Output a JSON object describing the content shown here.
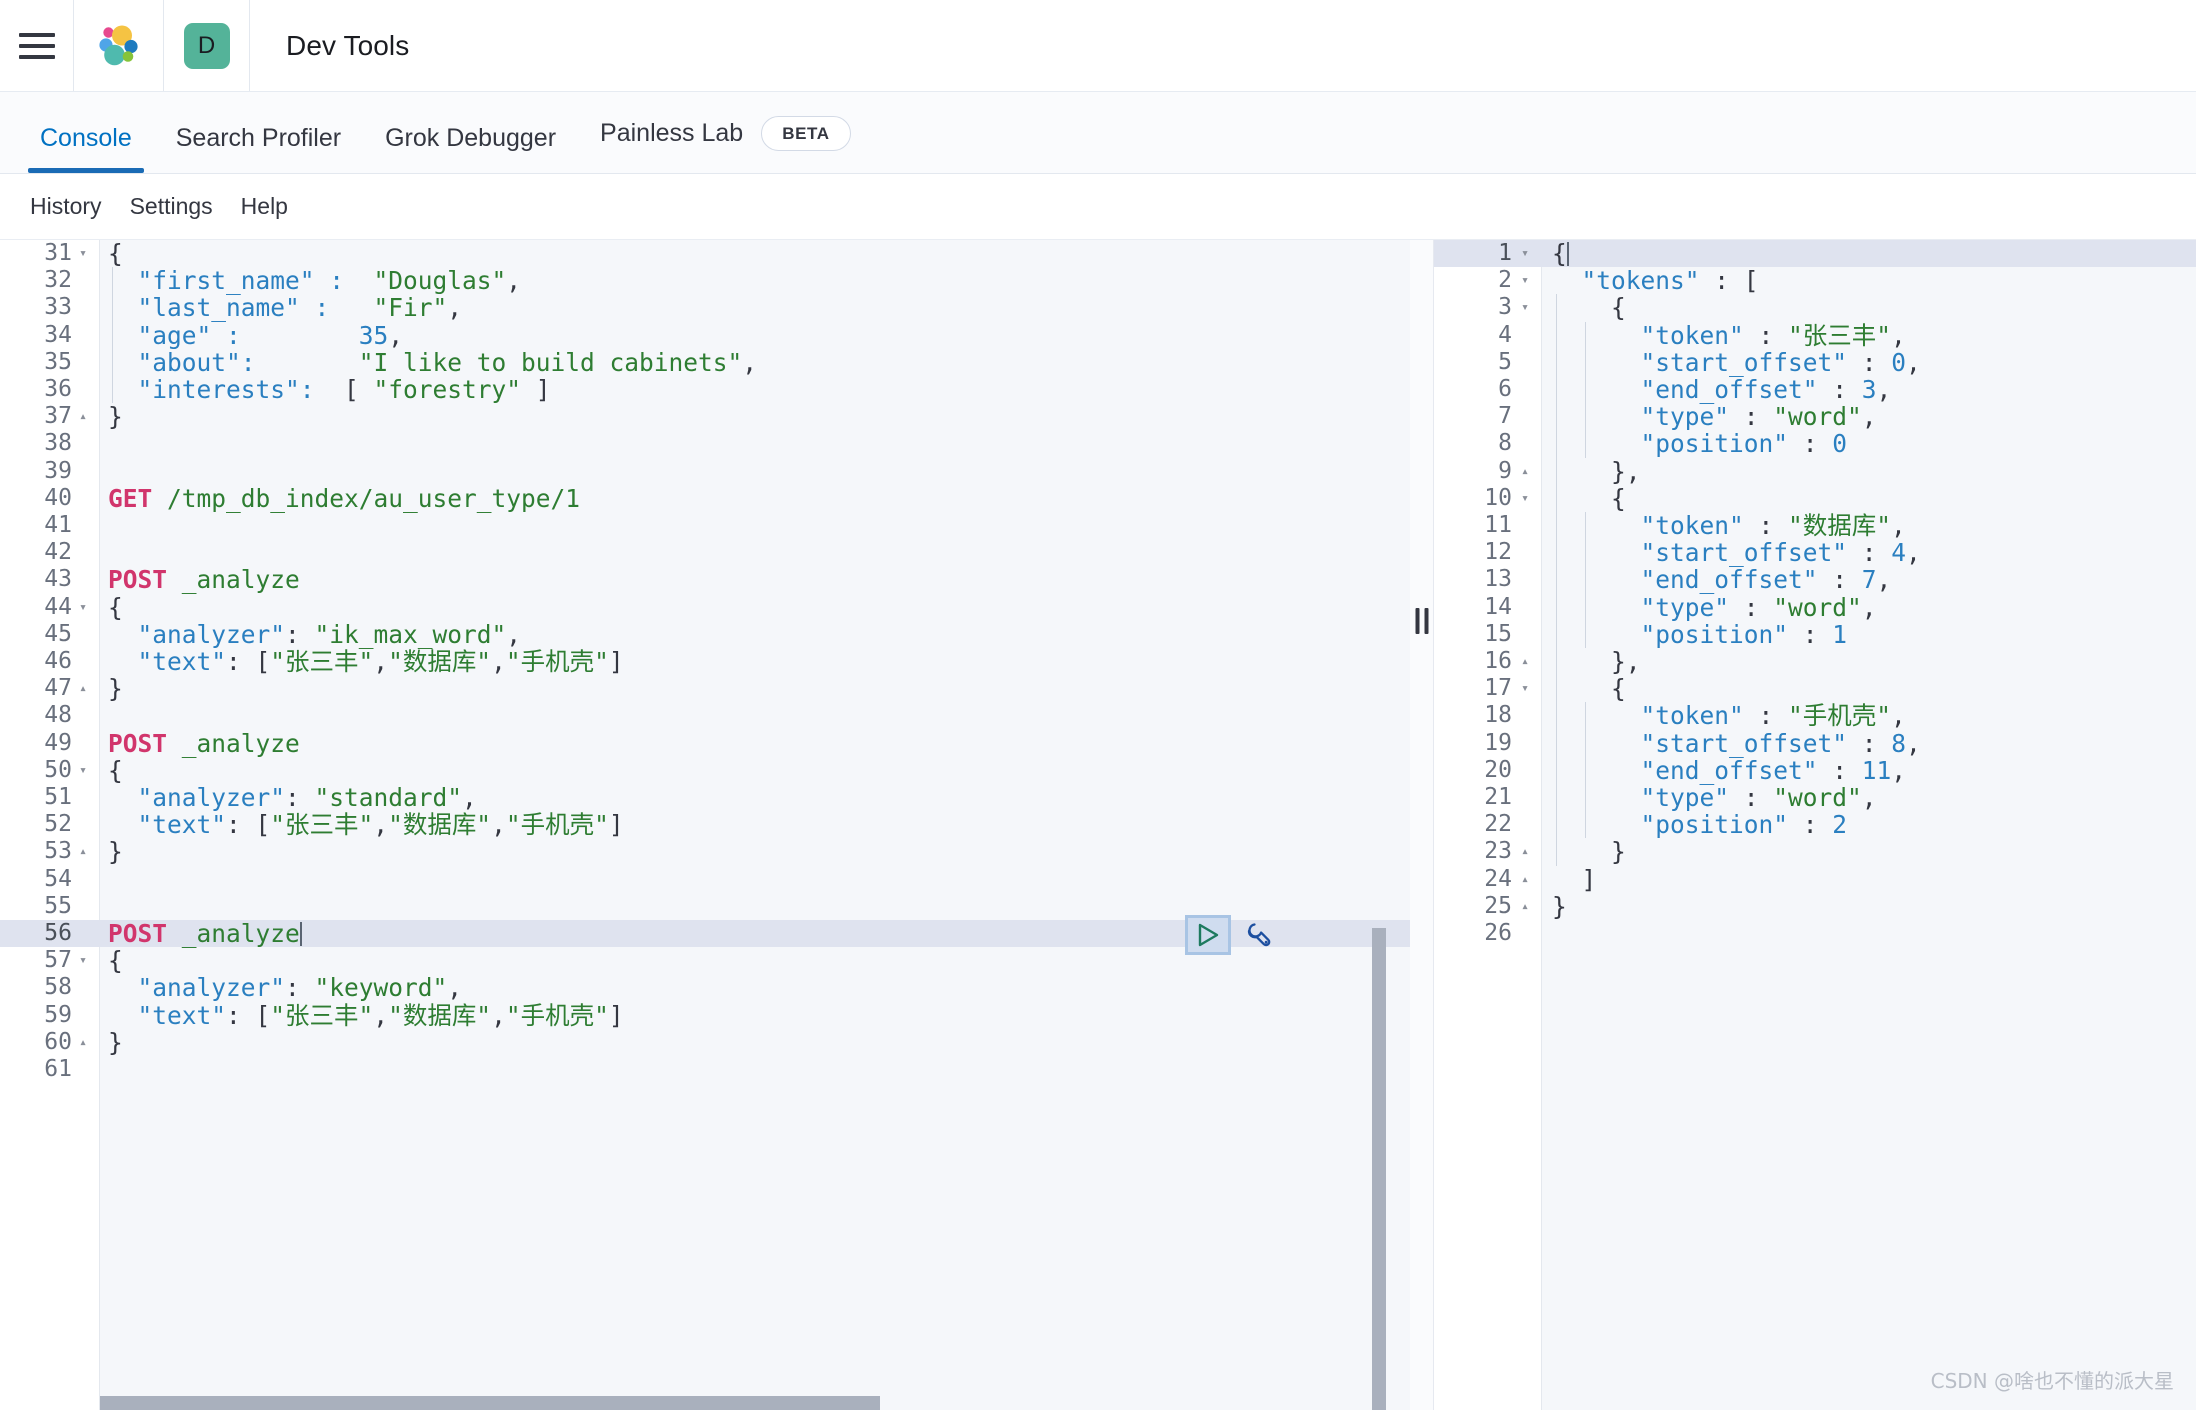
{
  "header": {
    "menu_icon": "hamburger-icon",
    "logo_icon": "elastic-logo-icon",
    "space_badge": "D",
    "app_title": "Dev Tools"
  },
  "tabs": [
    {
      "label": "Console",
      "active": true,
      "badge": null
    },
    {
      "label": "Search Profiler",
      "active": false,
      "badge": null
    },
    {
      "label": "Grok Debugger",
      "active": false,
      "badge": null
    },
    {
      "label": "Painless Lab",
      "active": false,
      "badge": "BETA"
    }
  ],
  "subnav": [
    {
      "label": "History"
    },
    {
      "label": "Settings"
    },
    {
      "label": "Help"
    }
  ],
  "editor": {
    "first_line": 31,
    "highlighted_line": 56,
    "caret_line": 56,
    "run_button": "send-request-play-icon",
    "wrench_button": "request-options-wrench-icon",
    "lines": [
      {
        "n": 31,
        "fold": "open",
        "indent": 0,
        "tokens": [
          {
            "t": "{",
            "c": "p"
          }
        ]
      },
      {
        "n": 32,
        "fold": null,
        "indent": 1,
        "tokens": [
          {
            "t": "  \"first_name\" :",
            "c": "k"
          },
          {
            "t": "  ",
            "c": "p"
          },
          {
            "t": "\"Douglas\"",
            "c": "s"
          },
          {
            "t": ",",
            "c": "p"
          }
        ]
      },
      {
        "n": 33,
        "fold": null,
        "indent": 1,
        "tokens": [
          {
            "t": "  \"last_name\" :",
            "c": "k"
          },
          {
            "t": "   ",
            "c": "p"
          },
          {
            "t": "\"Fir\"",
            "c": "s"
          },
          {
            "t": ",",
            "c": "p"
          }
        ]
      },
      {
        "n": 34,
        "fold": null,
        "indent": 1,
        "tokens": [
          {
            "t": "  \"age\" :",
            "c": "k"
          },
          {
            "t": "        ",
            "c": "p"
          },
          {
            "t": "35",
            "c": "n"
          },
          {
            "t": ",",
            "c": "p"
          }
        ]
      },
      {
        "n": 35,
        "fold": null,
        "indent": 1,
        "tokens": [
          {
            "t": "  \"about\":",
            "c": "k"
          },
          {
            "t": "       ",
            "c": "p"
          },
          {
            "t": "\"I like to build cabinets\"",
            "c": "s"
          },
          {
            "t": ",",
            "c": "p"
          }
        ]
      },
      {
        "n": 36,
        "fold": null,
        "indent": 1,
        "tokens": [
          {
            "t": "  \"interests\":",
            "c": "k"
          },
          {
            "t": "  [ ",
            "c": "p"
          },
          {
            "t": "\"forestry\"",
            "c": "s"
          },
          {
            "t": " ]",
            "c": "p"
          }
        ]
      },
      {
        "n": 37,
        "fold": "close",
        "indent": 0,
        "tokens": [
          {
            "t": "}",
            "c": "p"
          }
        ]
      },
      {
        "n": 38,
        "fold": null,
        "indent": 0,
        "tokens": []
      },
      {
        "n": 39,
        "fold": null,
        "indent": 0,
        "tokens": []
      },
      {
        "n": 40,
        "fold": null,
        "indent": 0,
        "tokens": [
          {
            "t": "GET",
            "c": "m"
          },
          {
            "t": " ",
            "c": "p"
          },
          {
            "t": "/tmp_db_index/au_user_type/1",
            "c": "u"
          }
        ]
      },
      {
        "n": 41,
        "fold": null,
        "indent": 0,
        "tokens": []
      },
      {
        "n": 42,
        "fold": null,
        "indent": 0,
        "tokens": []
      },
      {
        "n": 43,
        "fold": null,
        "indent": 0,
        "tokens": [
          {
            "t": "POST",
            "c": "m"
          },
          {
            "t": " ",
            "c": "p"
          },
          {
            "t": "_analyze",
            "c": "u"
          }
        ]
      },
      {
        "n": 44,
        "fold": "open",
        "indent": 0,
        "tokens": [
          {
            "t": "{",
            "c": "p"
          }
        ]
      },
      {
        "n": 45,
        "fold": null,
        "indent": 0,
        "tokens": [
          {
            "t": "  \"analyzer\"",
            "c": "k"
          },
          {
            "t": ": ",
            "c": "p"
          },
          {
            "t": "\"ik_max_word\"",
            "c": "s"
          },
          {
            "t": ",",
            "c": "p"
          }
        ]
      },
      {
        "n": 46,
        "fold": null,
        "indent": 0,
        "tokens": [
          {
            "t": "  \"text\"",
            "c": "k"
          },
          {
            "t": ": [",
            "c": "p"
          },
          {
            "t": "\"张三丰\"",
            "c": "s"
          },
          {
            "t": ",",
            "c": "p"
          },
          {
            "t": "\"数据库\"",
            "c": "s"
          },
          {
            "t": ",",
            "c": "p"
          },
          {
            "t": "\"手机壳\"",
            "c": "s"
          },
          {
            "t": "]",
            "c": "p"
          }
        ]
      },
      {
        "n": 47,
        "fold": "close",
        "indent": 0,
        "tokens": [
          {
            "t": "}",
            "c": "p"
          }
        ]
      },
      {
        "n": 48,
        "fold": null,
        "indent": 0,
        "tokens": []
      },
      {
        "n": 49,
        "fold": null,
        "indent": 0,
        "tokens": [
          {
            "t": "POST",
            "c": "m"
          },
          {
            "t": " ",
            "c": "p"
          },
          {
            "t": "_analyze",
            "c": "u"
          }
        ]
      },
      {
        "n": 50,
        "fold": "open",
        "indent": 0,
        "tokens": [
          {
            "t": "{",
            "c": "p"
          }
        ]
      },
      {
        "n": 51,
        "fold": null,
        "indent": 0,
        "tokens": [
          {
            "t": "  \"analyzer\"",
            "c": "k"
          },
          {
            "t": ": ",
            "c": "p"
          },
          {
            "t": "\"standard\"",
            "c": "s"
          },
          {
            "t": ",",
            "c": "p"
          }
        ]
      },
      {
        "n": 52,
        "fold": null,
        "indent": 0,
        "tokens": [
          {
            "t": "  \"text\"",
            "c": "k"
          },
          {
            "t": ": [",
            "c": "p"
          },
          {
            "t": "\"张三丰\"",
            "c": "s"
          },
          {
            "t": ",",
            "c": "p"
          },
          {
            "t": "\"数据库\"",
            "c": "s"
          },
          {
            "t": ",",
            "c": "p"
          },
          {
            "t": "\"手机壳\"",
            "c": "s"
          },
          {
            "t": "]",
            "c": "p"
          }
        ]
      },
      {
        "n": 53,
        "fold": "close",
        "indent": 0,
        "tokens": [
          {
            "t": "}",
            "c": "p"
          }
        ]
      },
      {
        "n": 54,
        "fold": null,
        "indent": 0,
        "tokens": []
      },
      {
        "n": 55,
        "fold": null,
        "indent": 0,
        "tokens": []
      },
      {
        "n": 56,
        "fold": null,
        "indent": 0,
        "highlight": true,
        "caret": true,
        "tokens": [
          {
            "t": "POST",
            "c": "m"
          },
          {
            "t": " ",
            "c": "p"
          },
          {
            "t": "_analyze",
            "c": "u"
          }
        ]
      },
      {
        "n": 57,
        "fold": "open",
        "indent": 0,
        "tokens": [
          {
            "t": "{",
            "c": "p"
          }
        ]
      },
      {
        "n": 58,
        "fold": null,
        "indent": 0,
        "tokens": [
          {
            "t": "  \"analyzer\"",
            "c": "k"
          },
          {
            "t": ": ",
            "c": "p"
          },
          {
            "t": "\"keyword\"",
            "c": "s"
          },
          {
            "t": ",",
            "c": "p"
          }
        ]
      },
      {
        "n": 59,
        "fold": null,
        "indent": 0,
        "tokens": [
          {
            "t": "  \"text\"",
            "c": "k"
          },
          {
            "t": ": [",
            "c": "p"
          },
          {
            "t": "\"张三丰\"",
            "c": "s"
          },
          {
            "t": ",",
            "c": "p"
          },
          {
            "t": "\"数据库\"",
            "c": "s"
          },
          {
            "t": ",",
            "c": "p"
          },
          {
            "t": "\"手机壳\"",
            "c": "s"
          },
          {
            "t": "]",
            "c": "p"
          }
        ]
      },
      {
        "n": 60,
        "fold": "close",
        "indent": 0,
        "tokens": [
          {
            "t": "}",
            "c": "p"
          }
        ]
      },
      {
        "n": 61,
        "fold": null,
        "indent": 0,
        "tokens": []
      }
    ]
  },
  "response": {
    "first_line": 1,
    "highlighted_line": 1,
    "lines": [
      {
        "n": 1,
        "fold": "open",
        "indent": 0,
        "highlight": true,
        "caret": true,
        "tokens": [
          {
            "t": "{",
            "c": "p"
          }
        ]
      },
      {
        "n": 2,
        "fold": "open",
        "indent": 0,
        "tokens": [
          {
            "t": "  \"tokens\"",
            "c": "k"
          },
          {
            "t": " : [",
            "c": "p"
          }
        ]
      },
      {
        "n": 3,
        "fold": "open",
        "indent": 1,
        "tokens": [
          {
            "t": "    {",
            "c": "p"
          }
        ]
      },
      {
        "n": 4,
        "fold": null,
        "indent": 2,
        "tokens": [
          {
            "t": "      \"token\"",
            "c": "k"
          },
          {
            "t": " : ",
            "c": "p"
          },
          {
            "t": "\"张三丰\"",
            "c": "s"
          },
          {
            "t": ",",
            "c": "p"
          }
        ]
      },
      {
        "n": 5,
        "fold": null,
        "indent": 2,
        "tokens": [
          {
            "t": "      \"start_offset\"",
            "c": "k"
          },
          {
            "t": " : ",
            "c": "p"
          },
          {
            "t": "0",
            "c": "n"
          },
          {
            "t": ",",
            "c": "p"
          }
        ]
      },
      {
        "n": 6,
        "fold": null,
        "indent": 2,
        "tokens": [
          {
            "t": "      \"end_offset\"",
            "c": "k"
          },
          {
            "t": " : ",
            "c": "p"
          },
          {
            "t": "3",
            "c": "n"
          },
          {
            "t": ",",
            "c": "p"
          }
        ]
      },
      {
        "n": 7,
        "fold": null,
        "indent": 2,
        "tokens": [
          {
            "t": "      \"type\"",
            "c": "k"
          },
          {
            "t": " : ",
            "c": "p"
          },
          {
            "t": "\"word\"",
            "c": "s"
          },
          {
            "t": ",",
            "c": "p"
          }
        ]
      },
      {
        "n": 8,
        "fold": null,
        "indent": 2,
        "tokens": [
          {
            "t": "      \"position\"",
            "c": "k"
          },
          {
            "t": " : ",
            "c": "p"
          },
          {
            "t": "0",
            "c": "n"
          }
        ]
      },
      {
        "n": 9,
        "fold": "close",
        "indent": 1,
        "tokens": [
          {
            "t": "    },",
            "c": "p"
          }
        ]
      },
      {
        "n": 10,
        "fold": "open",
        "indent": 1,
        "tokens": [
          {
            "t": "    {",
            "c": "p"
          }
        ]
      },
      {
        "n": 11,
        "fold": null,
        "indent": 2,
        "tokens": [
          {
            "t": "      \"token\"",
            "c": "k"
          },
          {
            "t": " : ",
            "c": "p"
          },
          {
            "t": "\"数据库\"",
            "c": "s"
          },
          {
            "t": ",",
            "c": "p"
          }
        ]
      },
      {
        "n": 12,
        "fold": null,
        "indent": 2,
        "tokens": [
          {
            "t": "      \"start_offset\"",
            "c": "k"
          },
          {
            "t": " : ",
            "c": "p"
          },
          {
            "t": "4",
            "c": "n"
          },
          {
            "t": ",",
            "c": "p"
          }
        ]
      },
      {
        "n": 13,
        "fold": null,
        "indent": 2,
        "tokens": [
          {
            "t": "      \"end_offset\"",
            "c": "k"
          },
          {
            "t": " : ",
            "c": "p"
          },
          {
            "t": "7",
            "c": "n"
          },
          {
            "t": ",",
            "c": "p"
          }
        ]
      },
      {
        "n": 14,
        "fold": null,
        "indent": 2,
        "tokens": [
          {
            "t": "      \"type\"",
            "c": "k"
          },
          {
            "t": " : ",
            "c": "p"
          },
          {
            "t": "\"word\"",
            "c": "s"
          },
          {
            "t": ",",
            "c": "p"
          }
        ]
      },
      {
        "n": 15,
        "fold": null,
        "indent": 2,
        "tokens": [
          {
            "t": "      \"position\"",
            "c": "k"
          },
          {
            "t": " : ",
            "c": "p"
          },
          {
            "t": "1",
            "c": "n"
          }
        ]
      },
      {
        "n": 16,
        "fold": "close",
        "indent": 1,
        "tokens": [
          {
            "t": "    },",
            "c": "p"
          }
        ]
      },
      {
        "n": 17,
        "fold": "open",
        "indent": 1,
        "tokens": [
          {
            "t": "    {",
            "c": "p"
          }
        ]
      },
      {
        "n": 18,
        "fold": null,
        "indent": 2,
        "tokens": [
          {
            "t": "      \"token\"",
            "c": "k"
          },
          {
            "t": " : ",
            "c": "p"
          },
          {
            "t": "\"手机壳\"",
            "c": "s"
          },
          {
            "t": ",",
            "c": "p"
          }
        ]
      },
      {
        "n": 19,
        "fold": null,
        "indent": 2,
        "tokens": [
          {
            "t": "      \"start_offset\"",
            "c": "k"
          },
          {
            "t": " : ",
            "c": "p"
          },
          {
            "t": "8",
            "c": "n"
          },
          {
            "t": ",",
            "c": "p"
          }
        ]
      },
      {
        "n": 20,
        "fold": null,
        "indent": 2,
        "tokens": [
          {
            "t": "      \"end_offset\"",
            "c": "k"
          },
          {
            "t": " : ",
            "c": "p"
          },
          {
            "t": "11",
            "c": "n"
          },
          {
            "t": ",",
            "c": "p"
          }
        ]
      },
      {
        "n": 21,
        "fold": null,
        "indent": 2,
        "tokens": [
          {
            "t": "      \"type\"",
            "c": "k"
          },
          {
            "t": " : ",
            "c": "p"
          },
          {
            "t": "\"word\"",
            "c": "s"
          },
          {
            "t": ",",
            "c": "p"
          }
        ]
      },
      {
        "n": 22,
        "fold": null,
        "indent": 2,
        "tokens": [
          {
            "t": "      \"position\"",
            "c": "k"
          },
          {
            "t": " : ",
            "c": "p"
          },
          {
            "t": "2",
            "c": "n"
          }
        ]
      },
      {
        "n": 23,
        "fold": "close",
        "indent": 1,
        "tokens": [
          {
            "t": "    }",
            "c": "p"
          }
        ]
      },
      {
        "n": 24,
        "fold": "close",
        "indent": 0,
        "tokens": [
          {
            "t": "  ]",
            "c": "p"
          }
        ]
      },
      {
        "n": 25,
        "fold": "close",
        "indent": 0,
        "tokens": [
          {
            "t": "}",
            "c": "p"
          }
        ]
      },
      {
        "n": 26,
        "fold": null,
        "indent": 0,
        "tokens": []
      }
    ]
  },
  "splitter": {
    "grip_icon": "drag-handle-icon"
  },
  "watermark": "CSDN @啥也不懂的派大星",
  "colors": {
    "accent_blue": "#0071c2",
    "tab_underline": "#1a6bb5",
    "space_badge_bg": "#54b399",
    "method": "#d1356c",
    "string": "#2e7d32",
    "key": "#2a7fc0",
    "editor_bg": "#f5f7fa",
    "highlight_row": "#dfe3ef"
  }
}
